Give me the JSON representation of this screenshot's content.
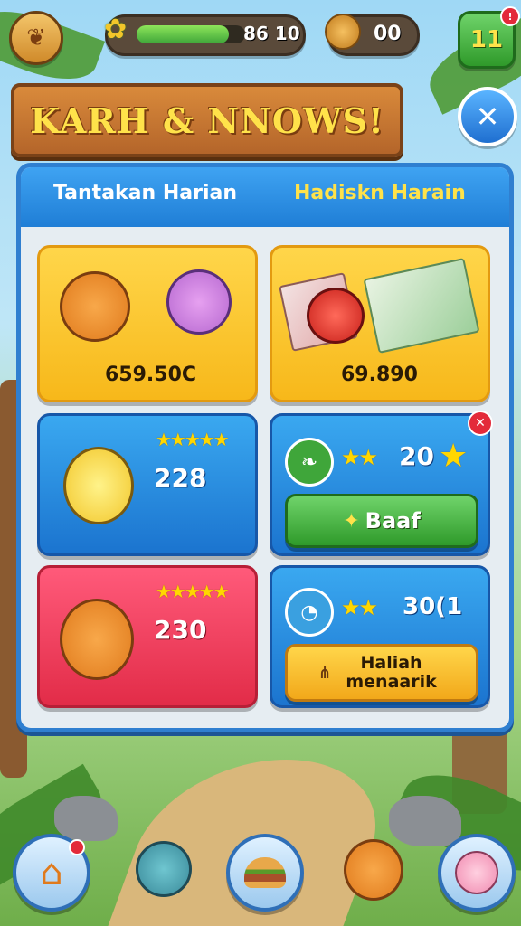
{
  "hud": {
    "progress_text": "86 10",
    "progress_fill": 0.85,
    "coins_text": "00",
    "level_text": "11"
  },
  "banner": {
    "title": "KARH & NNOWS!"
  },
  "tabs": [
    {
      "label": "Tantakan Harian"
    },
    {
      "label": "Hadiskn Harain"
    }
  ],
  "cards": {
    "friends": {
      "value": "659.50C"
    },
    "cash": {
      "value": "69.890"
    },
    "challenge_1": {
      "value": "228"
    },
    "reward_1": {
      "value": "20",
      "button": "Baaf"
    },
    "challenge_2": {
      "value": "230"
    },
    "reward_2": {
      "value": "30(1",
      "button": "Haliah menaarik"
    }
  },
  "colors": {
    "accent_blue": "#2f7fd0",
    "yellow_card": "#f7b81a",
    "red_card": "#e22c48",
    "green_button": "#3fa63a"
  }
}
